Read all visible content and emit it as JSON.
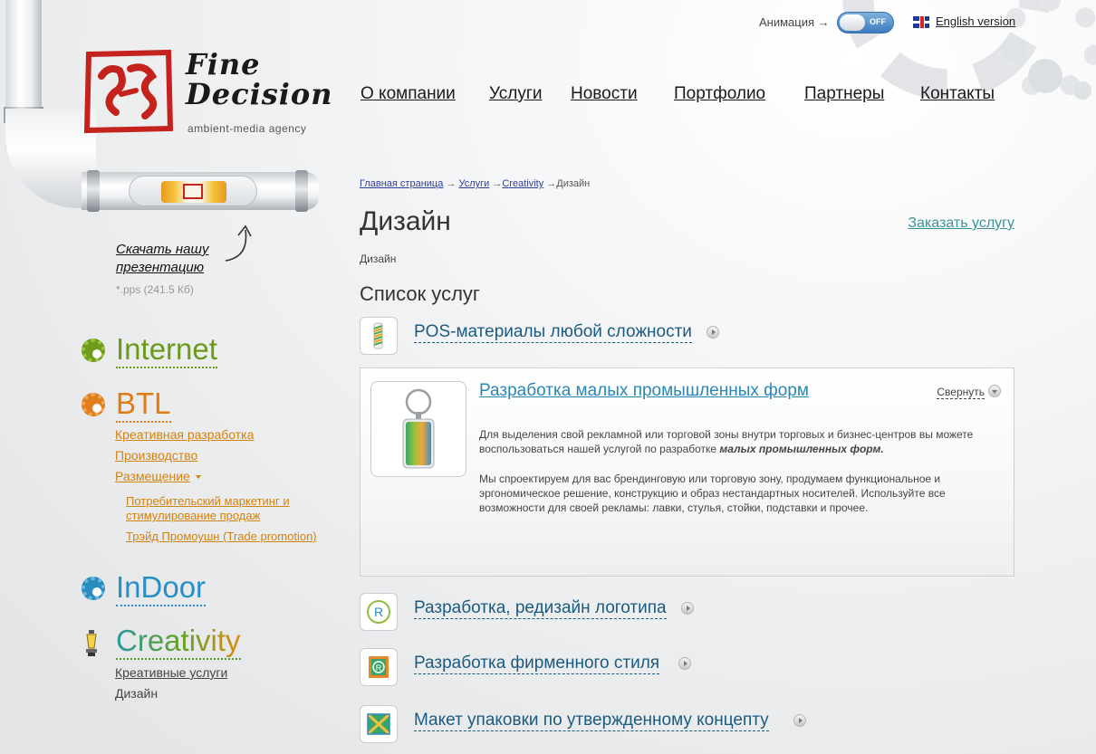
{
  "topbar": {
    "animation_label": "Анимация →",
    "toggle_state": "OFF",
    "english_link": "English version"
  },
  "logo": {
    "line1": "Fine",
    "line2": "Decision",
    "tagline": "ambient-media agency"
  },
  "nav": {
    "items": [
      {
        "label": "О компании"
      },
      {
        "label": "Услуги"
      },
      {
        "label": "Новости"
      },
      {
        "label": "Портфолио"
      },
      {
        "label": "Партнеры"
      },
      {
        "label": "Контакты"
      }
    ]
  },
  "download": {
    "link": "Скачать нашу презентацию",
    "info": "*.pps (241.5 Кб)"
  },
  "sidebar": {
    "categories": [
      {
        "title": "Internet",
        "color": "#6b9a1a",
        "icon": "gear-icon"
      },
      {
        "title": "BTL",
        "color": "#e27b12",
        "icon": "gear-icon",
        "items": [
          "Креативная разработка",
          "Производство",
          "Размещение"
        ],
        "subitems": [
          "Потребительский маркетинг и стимулирование продаж",
          "Трэйд Промоушн (Trade promotion)"
        ]
      },
      {
        "title": "InDoor",
        "color": "#2690c6",
        "icon": "gear-icon"
      },
      {
        "title": "Creativity",
        "color": "#5a9a2c",
        "icon": "lamp-icon",
        "items": [
          "Креативные услуги",
          "Дизайн"
        ]
      }
    ]
  },
  "breadcrumb": {
    "items": [
      "Главная страница",
      "Услуги",
      "Creativity"
    ],
    "separator": "→",
    "current": "Дизайн"
  },
  "page": {
    "title": "Дизайн",
    "order_link": "Заказать услугу",
    "subtitle": "Дизайн",
    "list_title": "Список услуг"
  },
  "services": [
    {
      "title": "POS-материалы любой сложности",
      "icon": "pos-materials-icon"
    },
    {
      "title": "Разработка малых промышленных форм",
      "icon": "keychain-icon",
      "expanded": true,
      "collapse_label": "Свернуть",
      "para1_plain": "Для выделения свой рекламной или торговой зоны внутри торговых и бизнес-центров вы можете воспользоваться нашей услугой по разработке ",
      "para1_emph": "малых промышленных форм.",
      "para2": "Мы спроектируем для вас брендинговую или торговую зону, продумаем функциональное и эргономическое решение, конструкцию и образ нестандартных носителей. Используйте все возможности для своей рекламы: лавки, стулья, стойки, подставки и прочее."
    },
    {
      "title": "Разработка, редизайн логотипа",
      "icon": "registered-logo-icon"
    },
    {
      "title": "Разработка фирменного стиля",
      "icon": "brand-style-icon"
    },
    {
      "title": "Макет упаковки по утвержденному концепту",
      "icon": "package-icon"
    }
  ],
  "colors": {
    "link_blue": "#1b5b80",
    "accent_teal": "#3d9495",
    "btl_orange": "#d4820f"
  }
}
